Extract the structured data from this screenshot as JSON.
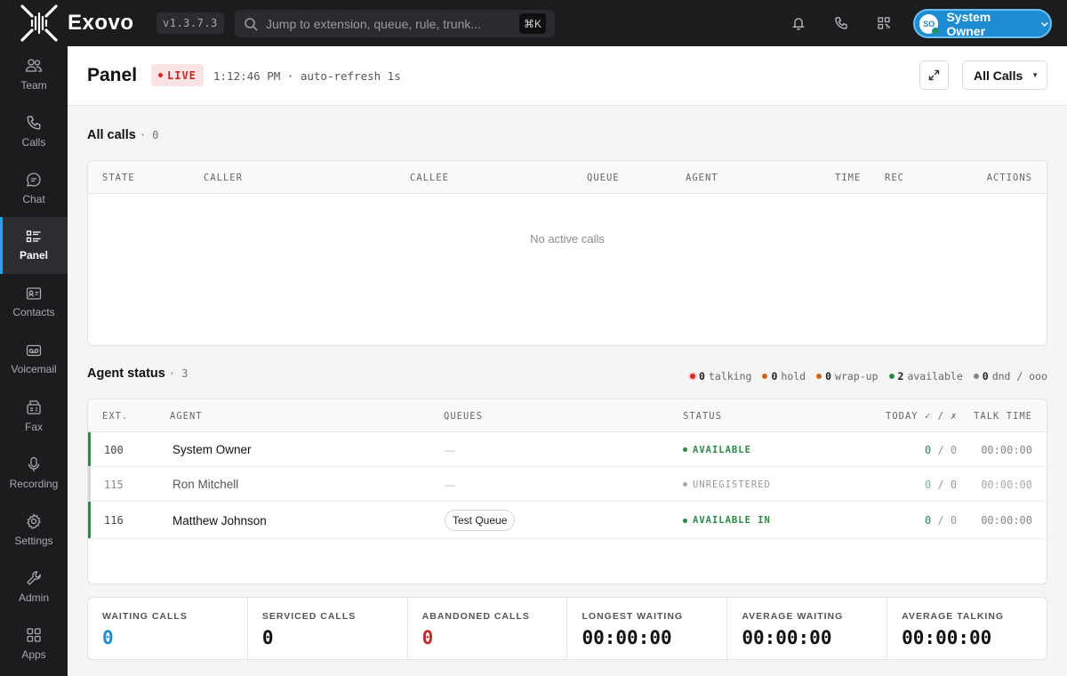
{
  "app": {
    "name": "Exovo",
    "version": "v1.3.7.3"
  },
  "search": {
    "placeholder": "Jump to extension, queue, rule, trunk...",
    "shortcut": "⌘K"
  },
  "user": {
    "initials": "SO",
    "name": "System Owner"
  },
  "sidebar": {
    "items": [
      {
        "label": "Team",
        "icon": "users-icon"
      },
      {
        "label": "Calls",
        "icon": "phone-icon"
      },
      {
        "label": "Chat",
        "icon": "chat-icon"
      },
      {
        "label": "Panel",
        "icon": "panel-list-icon",
        "active": true
      },
      {
        "label": "Contacts",
        "icon": "contact-card-icon"
      },
      {
        "label": "Voicemail",
        "icon": "voicemail-icon"
      },
      {
        "label": "Fax",
        "icon": "fax-icon"
      },
      {
        "label": "Recording",
        "icon": "microphone-icon"
      },
      {
        "label": "Settings",
        "icon": "gear-icon"
      },
      {
        "label": "Admin",
        "icon": "wrench-icon"
      },
      {
        "label": "Apps",
        "icon": "apps-grid-icon"
      }
    ]
  },
  "header": {
    "title": "Panel",
    "live": "LIVE",
    "time": "1:12:46 PM",
    "refresh": "auto-refresh 1s",
    "filter": "All Calls"
  },
  "calls": {
    "title": "All calls",
    "count": "0",
    "columns": [
      "STATE",
      "CALLER",
      "CALLEE",
      "QUEUE",
      "AGENT",
      "TIME",
      "REC",
      "ACTIONS"
    ],
    "empty": "No active calls"
  },
  "agents": {
    "title": "Agent status",
    "count": "3",
    "legend": [
      {
        "count": "0",
        "label": "talking",
        "color": "#d12b2b"
      },
      {
        "count": "0",
        "label": "hold",
        "color": "#c8661e"
      },
      {
        "count": "0",
        "label": "wrap-up",
        "color": "#c8661e"
      },
      {
        "count": "2",
        "label": "available",
        "color": "#2d8a47"
      },
      {
        "count": "0",
        "label": "dnd / ooo",
        "color": "#888888"
      }
    ],
    "columns": [
      "EXT.",
      "AGENT",
      "QUEUES",
      "STATUS",
      "TODAY ✓ / ✗",
      "TALK TIME"
    ],
    "rows": [
      {
        "ext": "100",
        "name": "System Owner",
        "queue": "—",
        "status": "AVAILABLE",
        "answered": "0",
        "missed": "0",
        "talk": "00:00:00"
      },
      {
        "ext": "115",
        "name": "Ron Mitchell",
        "queue": "—",
        "status": "UNREGISTERED",
        "answered": "0",
        "missed": "0",
        "talk": "00:00:00"
      },
      {
        "ext": "116",
        "name": "Matthew Johnson",
        "queue": "Test Queue",
        "status": "AVAILABLE IN",
        "answered": "0",
        "missed": "0",
        "talk": "00:00:00"
      }
    ]
  },
  "stats": [
    {
      "label": "WAITING CALLS",
      "value": "0",
      "color": "#1f8bd0"
    },
    {
      "label": "SERVICED CALLS",
      "value": "0",
      "color": "#111111"
    },
    {
      "label": "ABANDONED CALLS",
      "value": "0",
      "color": "#c42a2a"
    },
    {
      "label": "LONGEST WAITING",
      "value": "00:00:00",
      "color": "#111111"
    },
    {
      "label": "AVERAGE WAITING",
      "value": "00:00:00",
      "color": "#111111"
    },
    {
      "label": "AVERAGE TALKING",
      "value": "00:00:00",
      "color": "#111111"
    }
  ],
  "colors": {
    "accent": "#29a3e3",
    "available": "#2d8a47",
    "unregistered": "#999999",
    "live": "#c42a2a"
  }
}
